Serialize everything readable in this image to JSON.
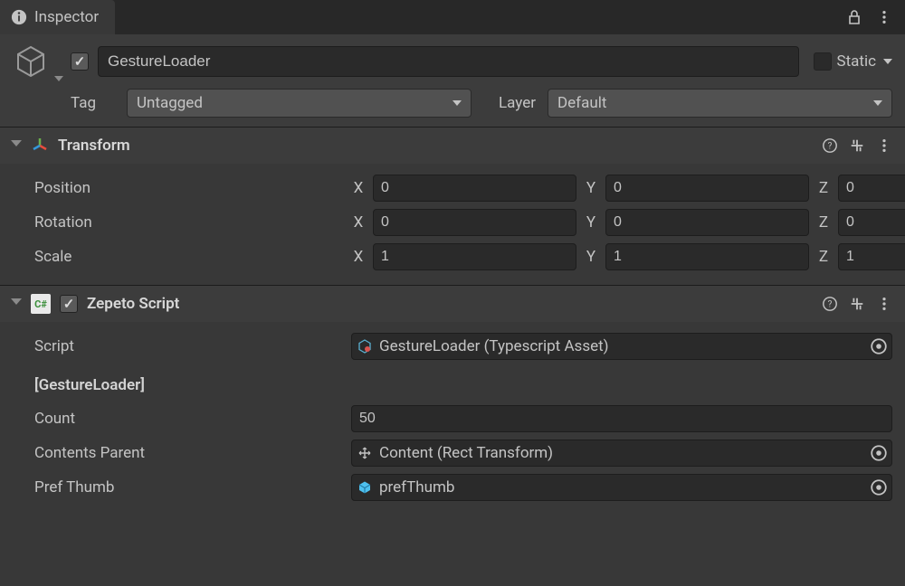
{
  "tab": {
    "title": "Inspector"
  },
  "gameObject": {
    "active": true,
    "name": "GestureLoader",
    "staticLabel": "Static",
    "tagLabel": "Tag",
    "tag": "Untagged",
    "layerLabel": "Layer",
    "layer": "Default"
  },
  "transform": {
    "title": "Transform",
    "position": {
      "label": "Position",
      "x": "0",
      "y": "0",
      "z": "0"
    },
    "rotation": {
      "label": "Rotation",
      "x": "0",
      "y": "0",
      "z": "0"
    },
    "scale": {
      "label": "Scale",
      "x": "1",
      "y": "1",
      "z": "1"
    }
  },
  "zepetoScript": {
    "title": "Zepeto Script",
    "scriptLabel": "Script",
    "scriptValue": "GestureLoader (Typescript Asset)",
    "classHeading": "[GestureLoader]",
    "countLabel": "Count",
    "countValue": "50",
    "contentsParentLabel": "Contents Parent",
    "contentsParentValue": "Content (Rect Transform)",
    "prefThumbLabel": "Pref Thumb",
    "prefThumbValue": "prefThumb"
  }
}
